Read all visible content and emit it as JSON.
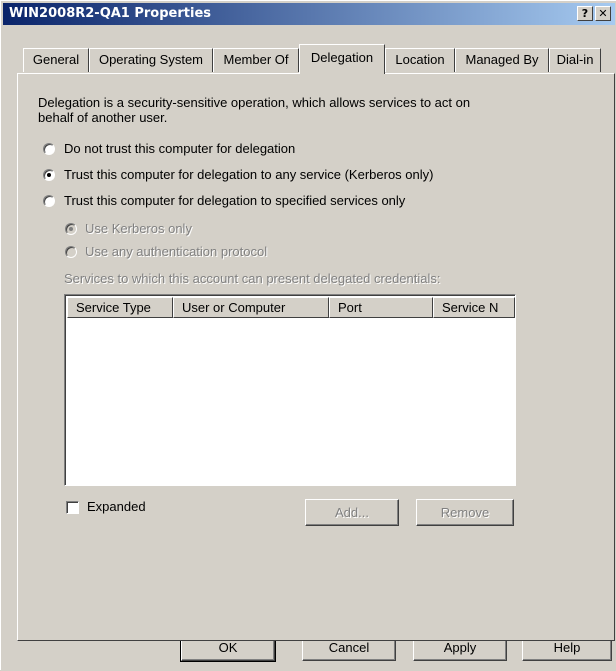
{
  "window": {
    "title": "WIN2008R2-QA1 Properties",
    "help_glyph": "?",
    "close_glyph": "✕"
  },
  "tabs": [
    {
      "label": "General"
    },
    {
      "label": "Operating System"
    },
    {
      "label": "Member Of"
    },
    {
      "label": "Delegation"
    },
    {
      "label": "Location"
    },
    {
      "label": "Managed By"
    },
    {
      "label": "Dial-in"
    }
  ],
  "delegation": {
    "description_line1": "Delegation is a security-sensitive operation, which allows services to act on",
    "description_line2": "behalf of another user.",
    "options": [
      {
        "label": "Do not trust this computer for delegation",
        "checked": false
      },
      {
        "label": "Trust this computer for delegation to any service (Kerberos only)",
        "checked": true
      },
      {
        "label": "Trust this computer for delegation to specified services only",
        "checked": false
      }
    ],
    "sub_options": [
      {
        "label": "Use Kerberos only",
        "checked": true
      },
      {
        "label": "Use any authentication protocol",
        "checked": false
      }
    ],
    "services_label": "Services to which this account can present delegated credentials:",
    "columns": [
      "Service Type",
      "User or Computer",
      "Port",
      "Service N"
    ],
    "expanded_label": "Expanded",
    "add_label": "Add...",
    "remove_label": "Remove"
  },
  "footer": {
    "ok": "OK",
    "cancel": "Cancel",
    "apply": "Apply",
    "help": "Help"
  }
}
